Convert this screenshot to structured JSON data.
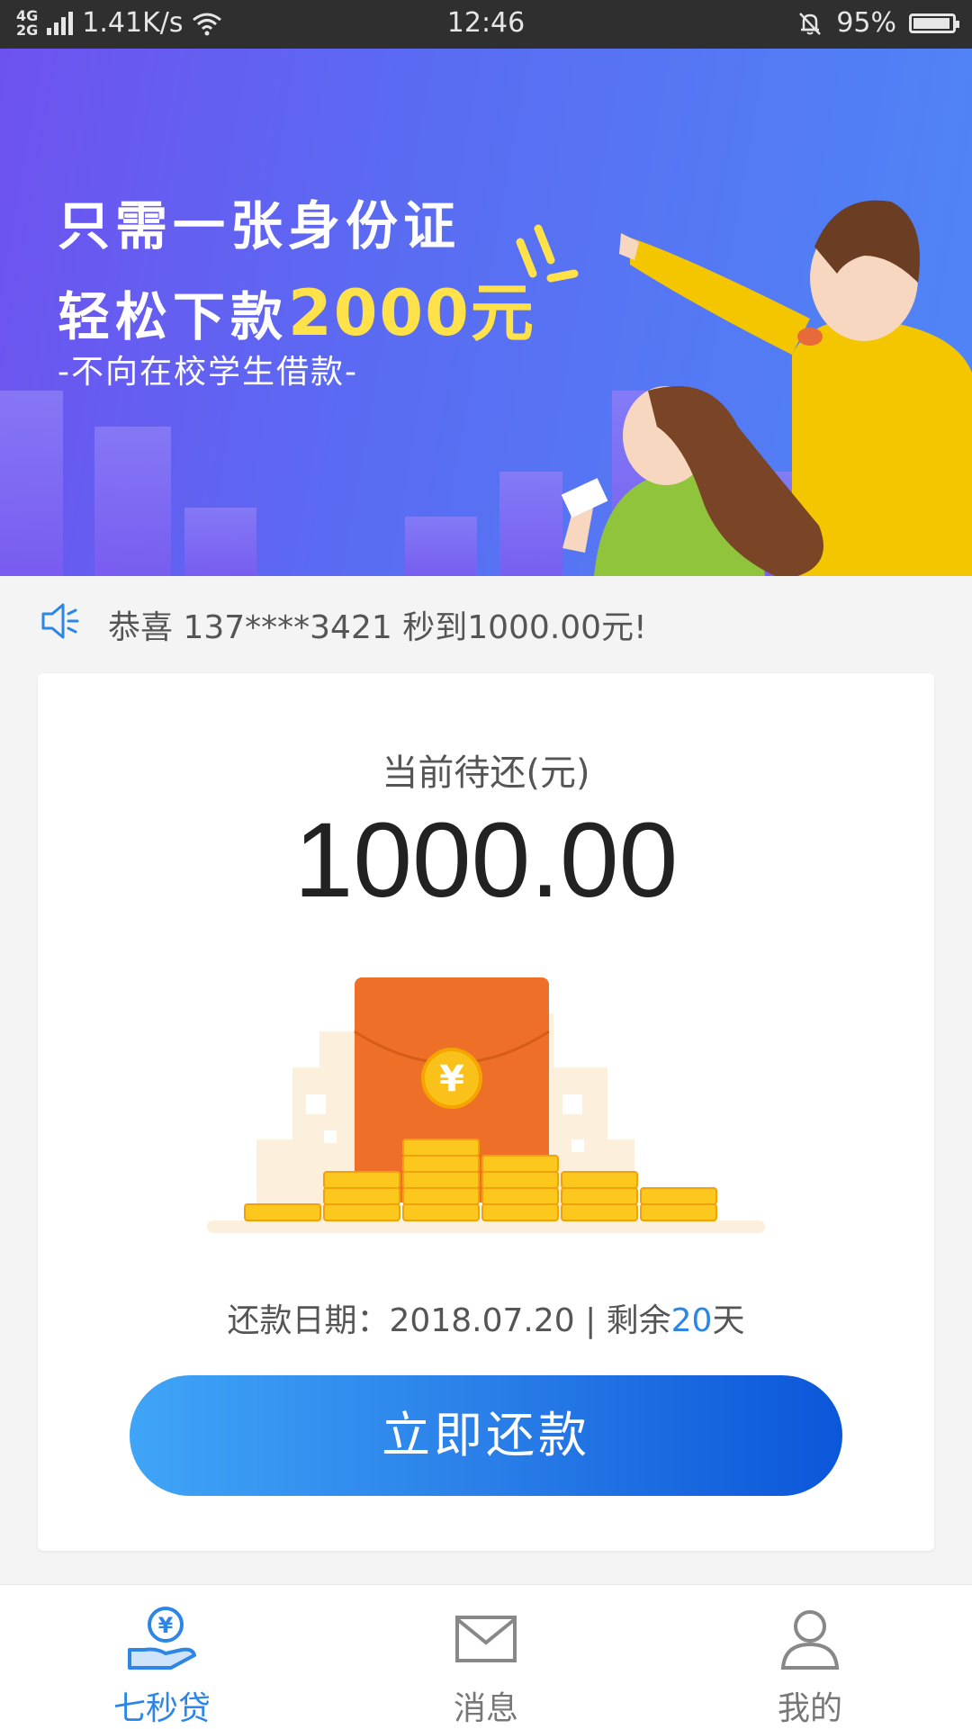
{
  "status_bar": {
    "network": [
      "4G",
      "2G"
    ],
    "speed": "1.41K/s",
    "time": "12:46",
    "battery": "95%"
  },
  "banner": {
    "line1": "只需一张身份证",
    "line2_prefix": "轻松下款",
    "line2_amount": "2000元",
    "subtitle": "-不向在校学生借款-"
  },
  "notice": {
    "icon": "speaker-icon",
    "text": "恭喜 137****3421 秒到1000.00元!"
  },
  "repay_card": {
    "label": "当前待还(元)",
    "amount": "1000.00",
    "due_prefix": "还款日期：2018.07.20 | 剩余",
    "due_days": "20",
    "due_suffix": "天",
    "button_label": "立即还款"
  },
  "tabbar": {
    "items": [
      {
        "label": "七秒贷",
        "icon": "loan-hand-icon",
        "active": true
      },
      {
        "label": "消息",
        "icon": "envelope-icon",
        "active": false
      },
      {
        "label": "我的",
        "icon": "user-icon",
        "active": false
      }
    ]
  },
  "colors": {
    "accent": "#2b86e6",
    "banner_start": "#6e52f0",
    "banner_end": "#4f86f6",
    "highlight": "#ffe14a",
    "button_start": "#3fa5f7",
    "button_end": "#0b56d9"
  }
}
